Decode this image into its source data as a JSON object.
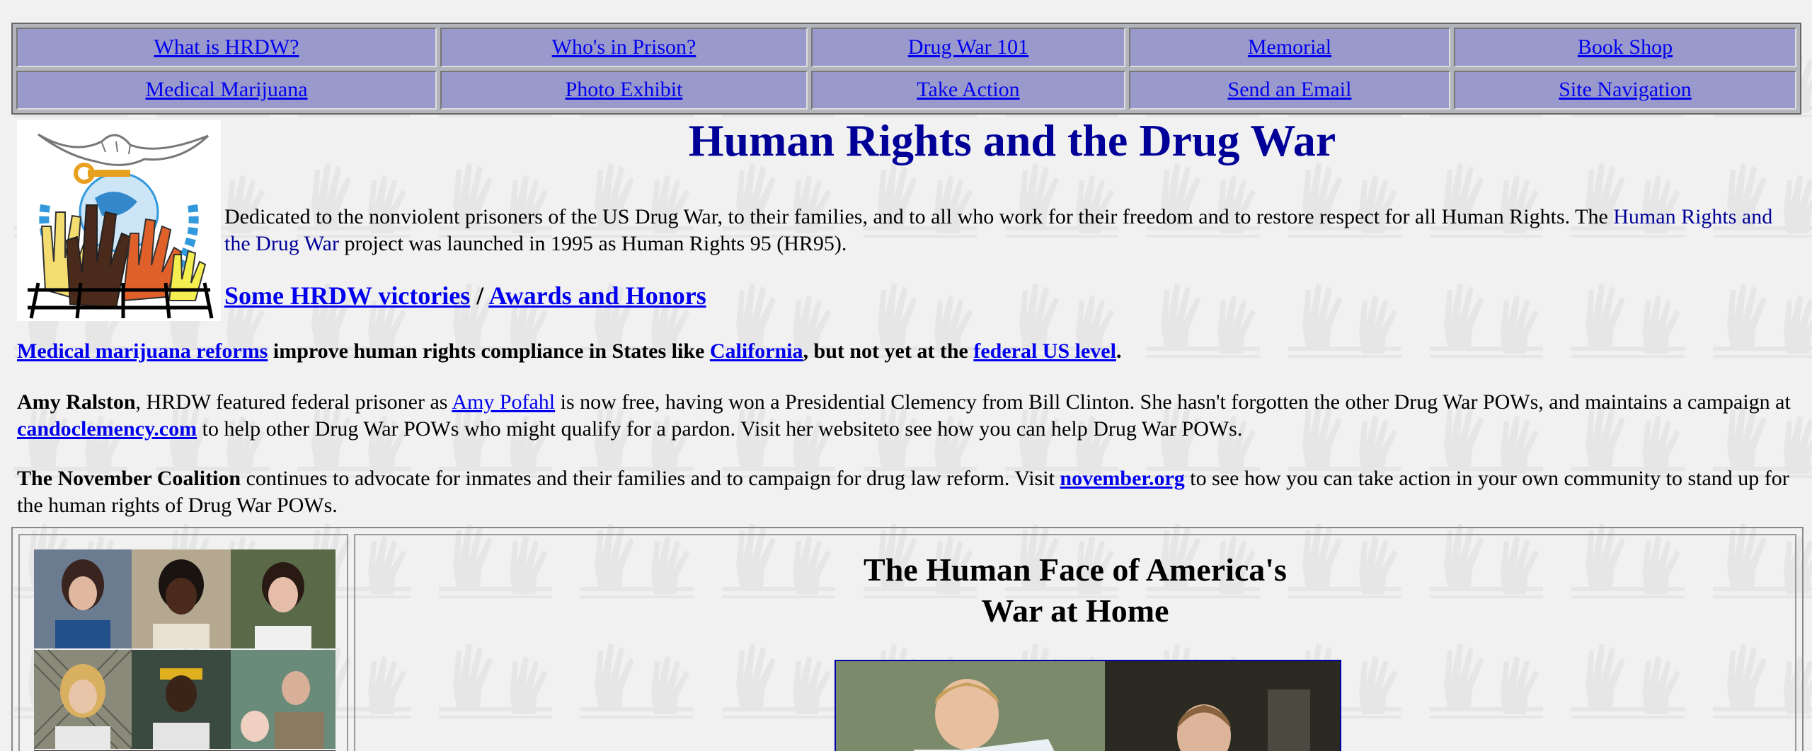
{
  "nav": {
    "row1": [
      "What is HRDW?",
      "Who's in Prison?",
      "Drug War 101",
      "Memorial",
      "Book Shop"
    ],
    "row2": [
      "Medical Marijuana",
      "Photo Exhibit",
      "Take Action",
      "Send an Email",
      "Site Navigation"
    ]
  },
  "header": {
    "title": "Human Rights and the Drug War",
    "intro_text": "Dedicated to the nonviolent prisoners of the US Drug War, to their families, and to all who work for their freedom and to restore respect for all Human Rights. The",
    "intro_link": "Human Rights and the Drug War",
    "intro_tail": "project was launched in 1995 as Human Rights 95 (HR95).",
    "victories_link": "Some HRDW victories",
    "separator": "/",
    "awards_link": "Awards and Honors"
  },
  "medical": {
    "link1": "Medical marijuana reforms",
    "text1": "improve human rights compliance in States like",
    "link2": "California",
    "text2": ", but not yet at the",
    "link3": "federal US level",
    "text3": "."
  },
  "amy": {
    "name": "Amy Ralston",
    "text1": ", HRDW featured federal prisoner as",
    "link1": "Amy Pofahl",
    "text2": "is now free, having won a Presidential Clemency from Bill Clinton. She hasn't forgotten the other Drug War POWs, and maintains a campaign at",
    "link2": "candoclemency.com",
    "text3": "to help other Drug War POWs who might qualify for a pardon. Visit her websiteto see how you can help Drug War POWs."
  },
  "november": {
    "name": "The November Coalition",
    "text1": "continues to advocate for inmates and their families and to campaign for drug law reform. Visit",
    "link1": "november.org",
    "text2": "to see how you can take action in your own community to stand up for the human rights of Drug War POWs."
  },
  "face": {
    "title_line1": "The Human Face of America's",
    "title_line2": "War at Home"
  },
  "colors": {
    "nav_cell": "#9999cc",
    "title": "#000099",
    "link": "#0000ee",
    "background": "#f1f1f1"
  }
}
